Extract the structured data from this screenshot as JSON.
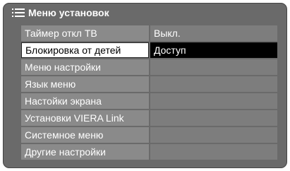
{
  "header": {
    "title": "Меню установок",
    "icon": "menu-list-icon"
  },
  "menu": {
    "items": [
      {
        "label": "Таймер откл ТВ",
        "value": "Выкл."
      },
      {
        "label": "Блокировка от детей",
        "value": "Доступ",
        "selected": true
      },
      {
        "label": "Меню настройки",
        "value": ""
      },
      {
        "label": "Язык меню",
        "value": ""
      },
      {
        "label": "Настойки экрана",
        "value": ""
      },
      {
        "label": "Установки VIERA Link",
        "value": ""
      },
      {
        "label": "Системное меню",
        "value": ""
      },
      {
        "label": "Другие настройки",
        "value": ""
      }
    ]
  },
  "colors": {
    "panel_bg": "#6a6a6a",
    "item_bg": "#8a8a8a",
    "selected_label_bg": "#ffffff",
    "selected_value_bg": "#000000"
  }
}
